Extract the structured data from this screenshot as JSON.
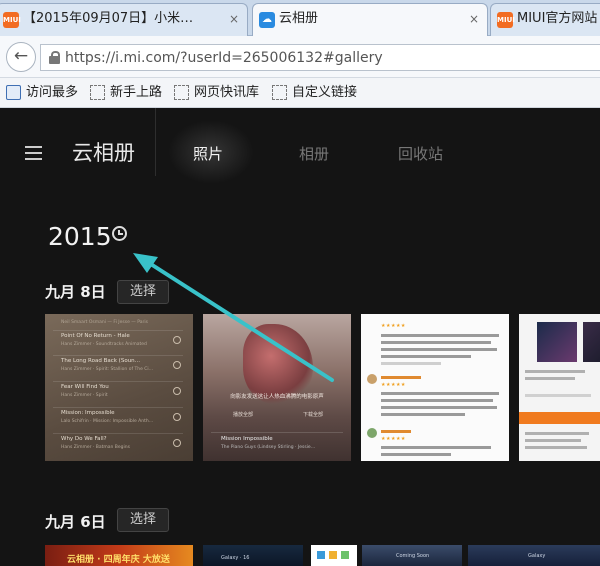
{
  "browser": {
    "tabs": [
      {
        "icon": "MIUI",
        "title": "【2015年09月07日】小米…",
        "close": "×",
        "active": false
      },
      {
        "icon": "☁",
        "title": "云相册",
        "close": "×",
        "active": true
      },
      {
        "icon": "MIUI",
        "title": "MIUI官方网站",
        "close": "",
        "active": false
      }
    ],
    "url": "https://i.mi.com/?userId=265006132#gallery",
    "back": "←",
    "bookmarks": [
      "访问最多",
      "新手上路",
      "网页快讯库",
      "自定义链接"
    ]
  },
  "app": {
    "title": "云相册",
    "nav": [
      {
        "label": "照片",
        "active": true
      },
      {
        "label": "相册",
        "active": false
      },
      {
        "label": "回收站",
        "active": false
      }
    ],
    "year": "2015",
    "groups": [
      {
        "date": "九月 8日",
        "select_label": "选择"
      },
      {
        "date": "九月 6日",
        "select_label": "选择"
      }
    ]
  },
  "thumb_playlist": {
    "header": "Neil Smaart Osmani — Fi Jesse — Paris",
    "songs": [
      {
        "title": "Point Of No Return - Hale",
        "sub": "Hans Zimmer · Soundtracks Animated"
      },
      {
        "title": "The Long Road Back (Soun…",
        "sub": "Hans Zimmer · Spirit: Stallion of The Ci…"
      },
      {
        "title": "Fear Will Find You",
        "sub": "Hans Zimmer · Spirit"
      },
      {
        "title": "Mission: Impossible",
        "sub": "Lalo Schifrin · Mission: Impossible Anth…"
      },
      {
        "title": "Why Do We Fall?",
        "sub": "Hans Zimmer · Batman Begins"
      }
    ]
  },
  "thumb_movie": {
    "caption": "向影友发送这让人热血沸腾的电影原声",
    "action_left": "播放全部",
    "action_right": "下载全部",
    "song_title": "Mission Impossible",
    "song_sub": "The Piano Guys (Lindsey Stirling · Jessie…"
  },
  "thumb_row2": {
    "banner": "云相册 · 四周年庆 大放送",
    "tile_b": "Galaxy · 16",
    "tile_d": "Coming Soon",
    "tile_e": "Galaxy"
  },
  "colors": {
    "app_bg": "#141414",
    "annotation_arrow": "#39c2c9",
    "accent_orange": "#f07a1e"
  }
}
